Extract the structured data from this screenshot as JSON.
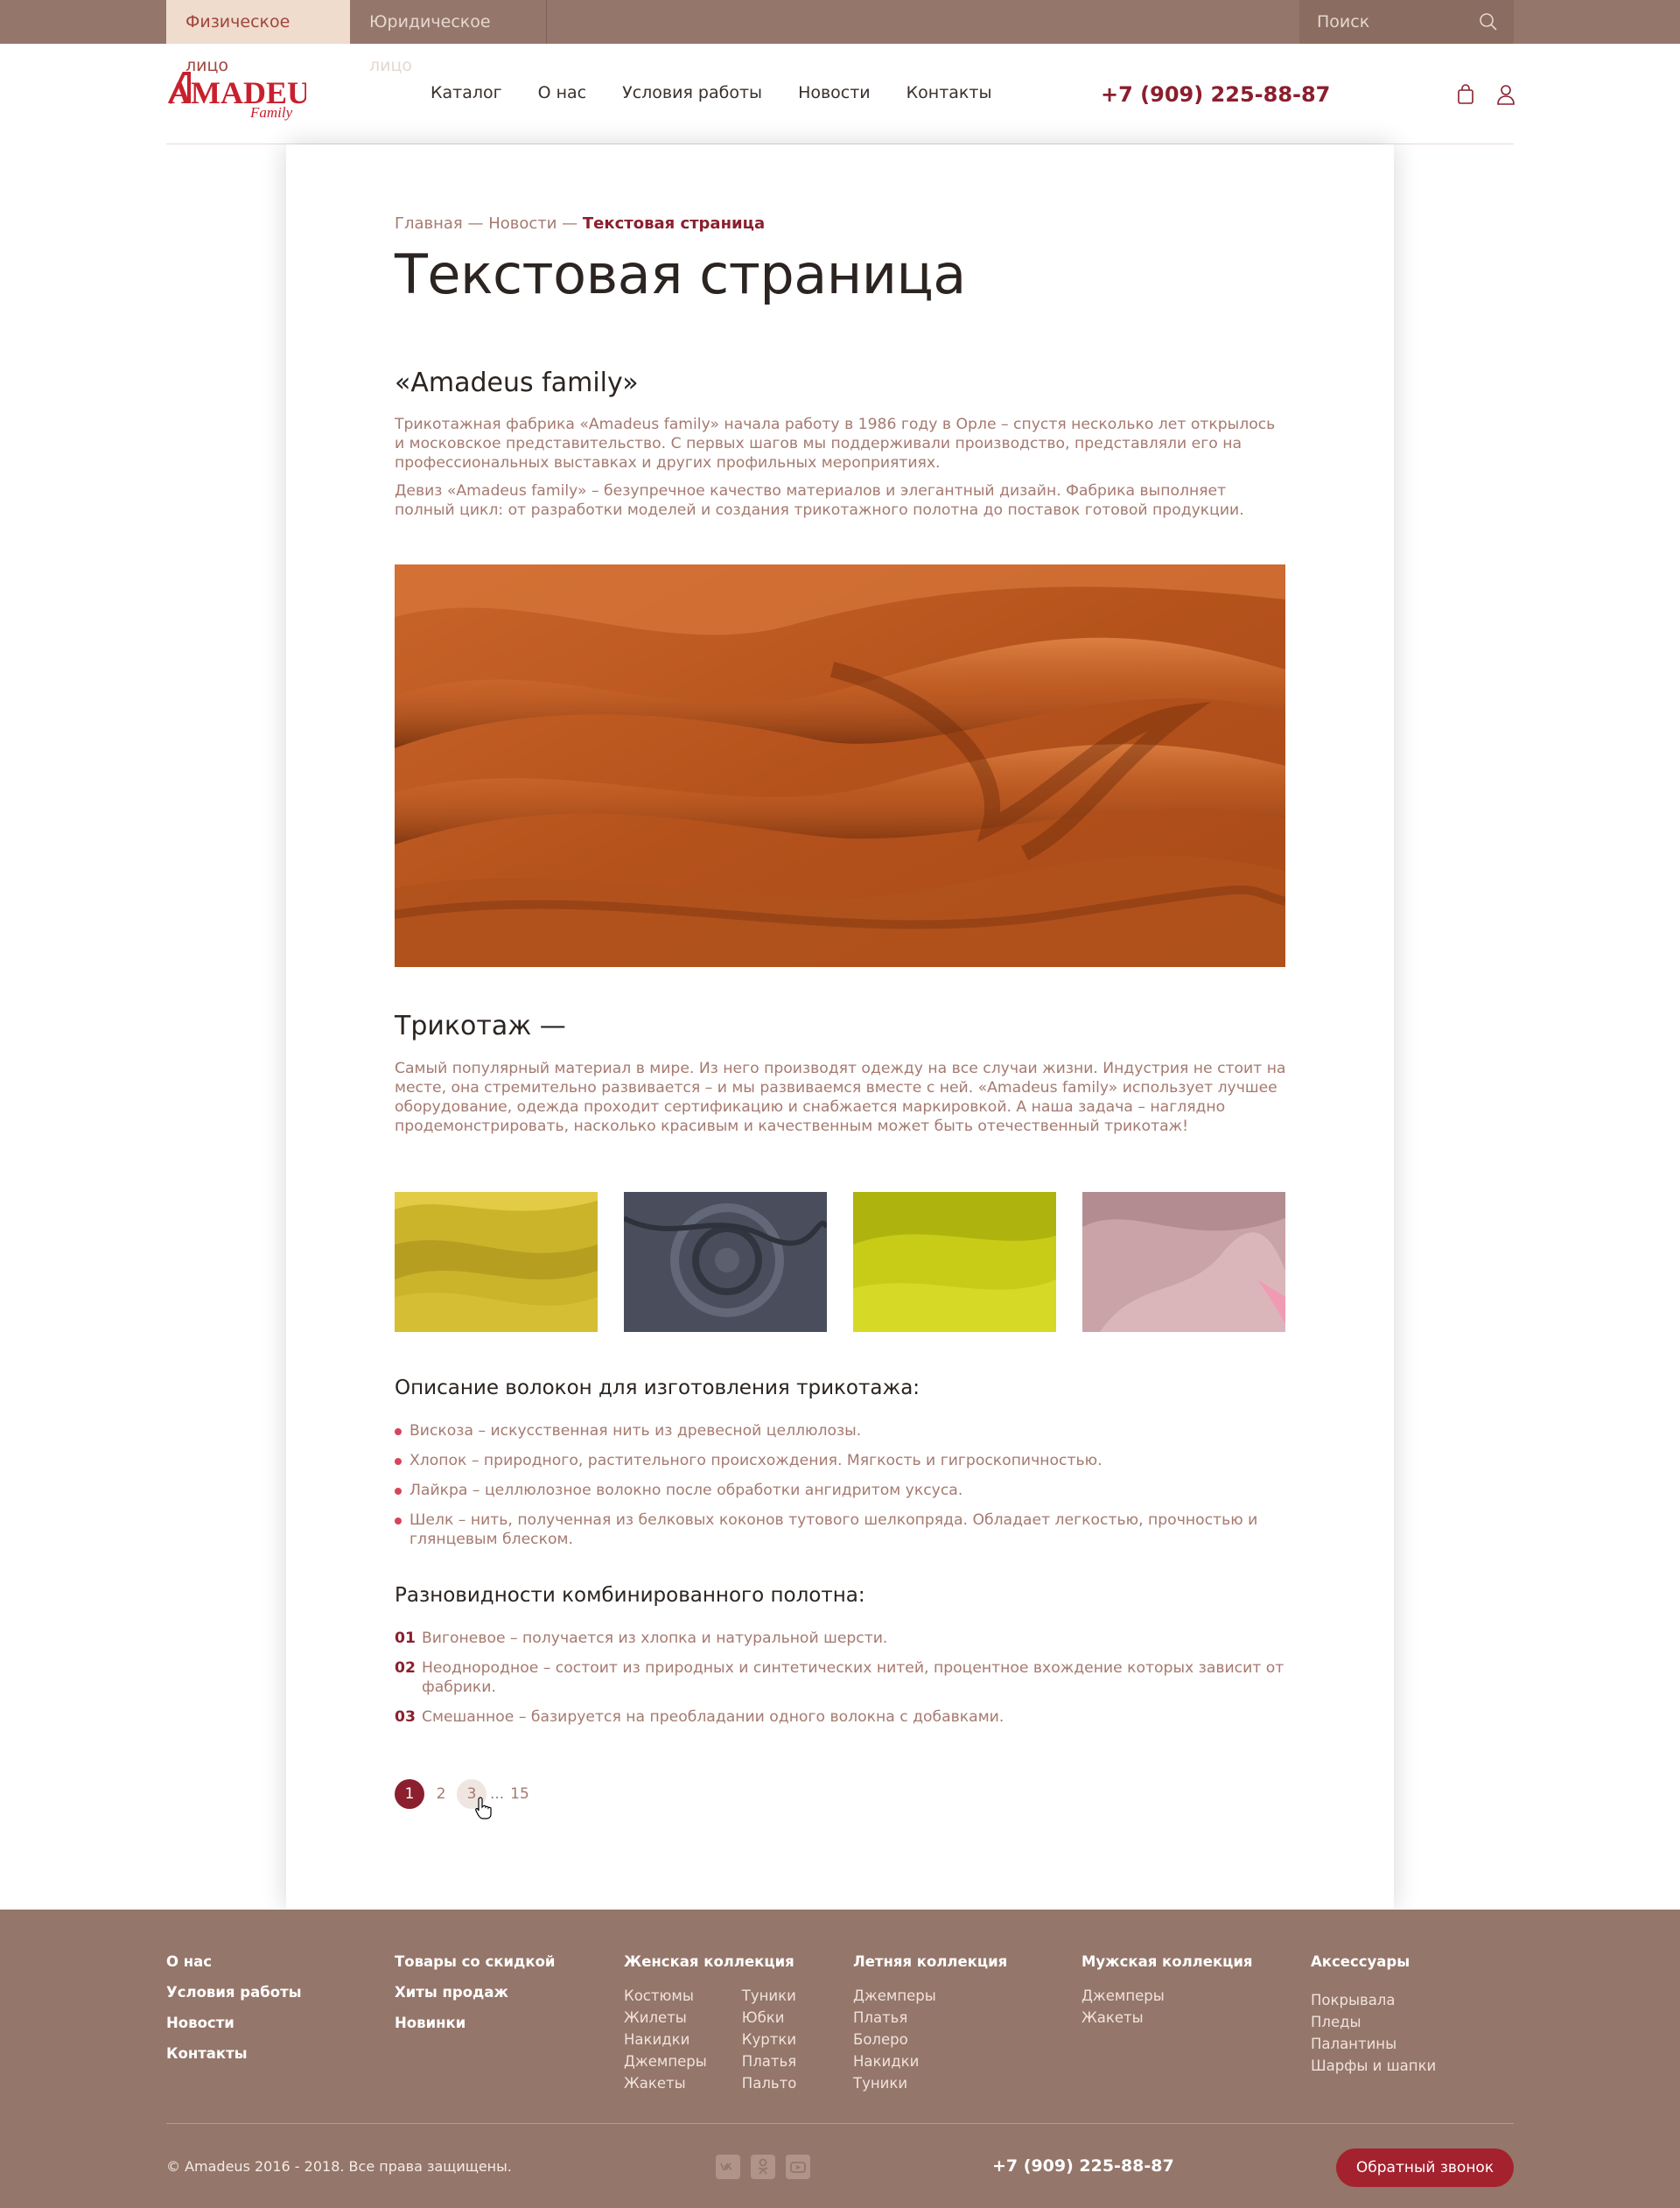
{
  "topbar": {
    "tab_individual": "Физическое лицо",
    "tab_legal": "Юридическое лицо",
    "search_placeholder": "Поиск"
  },
  "header": {
    "logo_text": "AMADEUS",
    "logo_sub": "Family",
    "nav": [
      "Каталог",
      "О нас",
      "Условия работы",
      "Новости",
      "Контакты"
    ],
    "phone": "+7 (909) 225-88-87"
  },
  "breadcrumb": {
    "home": "Главная",
    "sep": " — ",
    "news": "Новости",
    "current": "Текстовая страница"
  },
  "page_title": "Текстовая страница",
  "section1": {
    "title": "«Amadeus family»",
    "p1": "Трикотажная фабрика «Amadeus family» начала работу в 1986 году в Орле – спустя несколько лет открылось и московское представительство. С первых шагов мы поддерживали производство, представляли его на профессиональных выставках и других профильных мероприятиях.",
    "p2": "Девиз «Amadeus family» – безупречное качество материалов и элегантный дизайн. Фабрика выполняет полный цикл: от разработки моделей и создания трикотажного полотна до поставок готовой продукции."
  },
  "section2": {
    "title": "Трикотаж —",
    "p1": "Самый популярный материал в мире. Из него производят одежду на все случаи жизни. Индустрия не стоит на месте, она стремительно развивается – и мы развиваемся вместе с ней. «Amadeus family» использует лучшее оборудование, одежда проходит сертификацию и снабжается маркировкой. А наша задача – наглядно продемонстрировать, насколько красивым и качественным может быть отечественный трикотаж!"
  },
  "fibers": {
    "title": "Описание волокон для изготовления трикотажа:",
    "items": [
      "Вискоза – искусственная нить из древесной целлюлозы.",
      "Хлопок – природного, растительного происхождения. Мягкость и гигроскопичностью.",
      "Лайкра – целлюлозное волокно после обработки ангидритом уксуса.",
      "Шелк – нить, полученная из белковых коконов тутового шелкопряда. Обладает легкостью, прочностью и глянцевым блеском."
    ]
  },
  "varieties": {
    "title": "Разновидности комбинированного полотна:",
    "items": [
      {
        "num": "01",
        "text": "Вигоневое – получается из хлопка и натуральной шерсти."
      },
      {
        "num": "02",
        "text": "Неоднородное – состоит из природных и синтетических нитей, процентное вхождение которых зависит от фабрики."
      },
      {
        "num": "03",
        "text": "Смешанное – базируется на преобладании одного волокна с добавками."
      }
    ]
  },
  "pagination": {
    "pages": [
      "1",
      "2",
      "3"
    ],
    "ellipsis": "...",
    "last": "15",
    "current": "1"
  },
  "footer": {
    "col1": [
      "О нас",
      "Условия работы",
      "Новости",
      "Контакты"
    ],
    "col2": [
      "Товары со скидкой",
      "Хиты продаж",
      "Новинки"
    ],
    "women": {
      "title": "Женская коллекция",
      "left": [
        "Костюмы",
        "Жилеты",
        "Накидки",
        "Джемперы",
        "Жакеты"
      ],
      "right": [
        "Туники",
        "Юбки",
        "Куртки",
        "Платья",
        "Пальто"
      ]
    },
    "summer": {
      "title": "Летняя коллекция",
      "items": [
        "Джемперы",
        "Платья",
        "Болеро",
        "Накидки",
        "Туники"
      ]
    },
    "men": {
      "title": "Мужская коллекция",
      "items": [
        "Джемперы",
        "Жакеты"
      ]
    },
    "acc": {
      "title": "Аксессуары",
      "items": [
        "Покрывала",
        "Пледы",
        "Палантины",
        "Шарфы и шапки"
      ]
    },
    "copyright": "© Amadeus 2016 - 2018. Все права защищены.",
    "phone": "+7 (909) 225-88-87",
    "callback": "Обратный звонок",
    "social_icons": [
      "vk-icon",
      "odnoklassniki-icon",
      "youtube-icon"
    ]
  },
  "colors": {
    "accent": "#8b1f2e",
    "topbar": "#94766a",
    "footer": "#94766a",
    "text_muted": "#a57a70",
    "bullet": "#d6455b",
    "callback_button": "#a4212e"
  }
}
